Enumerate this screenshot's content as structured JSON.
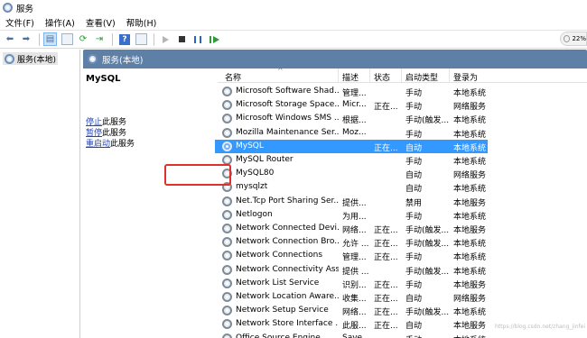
{
  "window": {
    "title": "服务"
  },
  "menu": [
    "文件(F)",
    "操作(A)",
    "查看(V)",
    "帮助(H)"
  ],
  "netwidget": {
    "value": "22%"
  },
  "tree": {
    "root_label": "服务(本地)"
  },
  "panel": {
    "header": "服务(本地)"
  },
  "detail": {
    "service_name": "MySQL",
    "stop_link": "停止",
    "stop_suffix": "此服务",
    "pause_link": "暂停",
    "pause_suffix": "此服务",
    "restart_link": "重启动",
    "restart_suffix": "此服务"
  },
  "columns": [
    "名称",
    "描述",
    "状态",
    "启动类型",
    "登录为"
  ],
  "rows": [
    {
      "name": "Microsoft Software Shad...",
      "desc": "管理...",
      "status": "",
      "startup": "手动",
      "logon": "本地系统"
    },
    {
      "name": "Microsoft Storage Space...",
      "desc": "Micr...",
      "status": "正在...",
      "startup": "手动",
      "logon": "网络服务"
    },
    {
      "name": "Microsoft Windows SMS ...",
      "desc": "根据...",
      "status": "",
      "startup": "手动(触发...",
      "logon": "本地系统"
    },
    {
      "name": "Mozilla Maintenance Ser...",
      "desc": "Moz...",
      "status": "",
      "startup": "手动",
      "logon": "本地系统"
    },
    {
      "name": "MySQL",
      "desc": "",
      "status": "正在...",
      "startup": "自动",
      "logon": "本地系统"
    },
    {
      "name": "MySQL Router",
      "desc": "",
      "status": "",
      "startup": "手动",
      "logon": "本地系统"
    },
    {
      "name": "MySQL80",
      "desc": "",
      "status": "",
      "startup": "自动",
      "logon": "网络服务"
    },
    {
      "name": "mysqlzt",
      "desc": "",
      "status": "",
      "startup": "自动",
      "logon": "本地系统"
    },
    {
      "name": "Net.Tcp Port Sharing Ser...",
      "desc": "提供...",
      "status": "",
      "startup": "禁用",
      "logon": "本地服务"
    },
    {
      "name": "Netlogon",
      "desc": "为用...",
      "status": "",
      "startup": "手动",
      "logon": "本地系统"
    },
    {
      "name": "Network Connected Devi...",
      "desc": "网络...",
      "status": "正在...",
      "startup": "手动(触发...",
      "logon": "本地服务"
    },
    {
      "name": "Network Connection Bro...",
      "desc": "允许 ...",
      "status": "正在...",
      "startup": "手动(触发...",
      "logon": "本地系统"
    },
    {
      "name": "Network Connections",
      "desc": "管理...",
      "status": "正在...",
      "startup": "手动",
      "logon": "本地系统"
    },
    {
      "name": "Network Connectivity Ass...",
      "desc": "提供 ...",
      "status": "",
      "startup": "手动(触发...",
      "logon": "本地系统"
    },
    {
      "name": "Network List Service",
      "desc": "识别...",
      "status": "正在...",
      "startup": "手动",
      "logon": "本地服务"
    },
    {
      "name": "Network Location Aware...",
      "desc": "收集...",
      "status": "正在...",
      "startup": "自动",
      "logon": "网络服务"
    },
    {
      "name": "Network Setup Service",
      "desc": "网络...",
      "status": "正在...",
      "startup": "手动(触发...",
      "logon": "本地系统"
    },
    {
      "name": "Network Store Interface ...",
      "desc": "此服...",
      "status": "正在...",
      "startup": "自动",
      "logon": "本地服务"
    },
    {
      "name": "Office  Source Engine",
      "desc": "Save...",
      "status": "",
      "startup": "手动",
      "logon": "本地系统"
    }
  ],
  "selected_index": 4,
  "watermark": "https://blog.csdn.net/zhang_jinfei"
}
